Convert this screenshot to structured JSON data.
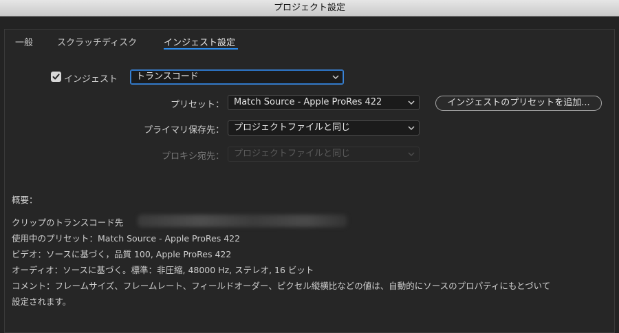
{
  "window": {
    "title": "プロジェクト設定"
  },
  "tabs": [
    {
      "label": "一般"
    },
    {
      "label": "スクラッチディスク"
    },
    {
      "label": "インジェスト設定"
    }
  ],
  "ingest": {
    "checkbox_label": "インジェスト",
    "checked": true,
    "mode_value": "トランスコード"
  },
  "preset": {
    "label": "プリセット：",
    "value": "Match Source - Apple ProRes 422",
    "add_button_label": "インジェストのプリセットを追加..."
  },
  "primary_destination": {
    "label": "プライマリ保存先：",
    "value": "プロジェクトファイルと同じ"
  },
  "proxy_destination": {
    "label": "プロキシ宛先：",
    "value": "プロジェクトファイルと同じ"
  },
  "summary": {
    "heading": "概要：",
    "lines": [
      "クリップのトランスコード先",
      "使用中のプリセット：Match Source - Apple ProRes 422",
      "ビデオ：ソースに基づく，品質 100, Apple ProRes 422",
      "オーディオ：ソースに基づく。標準：非圧縮, 48000 Hz, ステレオ, 16 ビット",
      "コメント：フレームサイズ、フレームレート、フィールドオーダー、ピクセル縦横比などの値は、自動的にソースのプロパティにもとづいて",
      "設定されます。"
    ]
  },
  "colors": {
    "accent": "#2d8ceb",
    "background": "#232323",
    "titlebar": "#d6d6d6"
  }
}
